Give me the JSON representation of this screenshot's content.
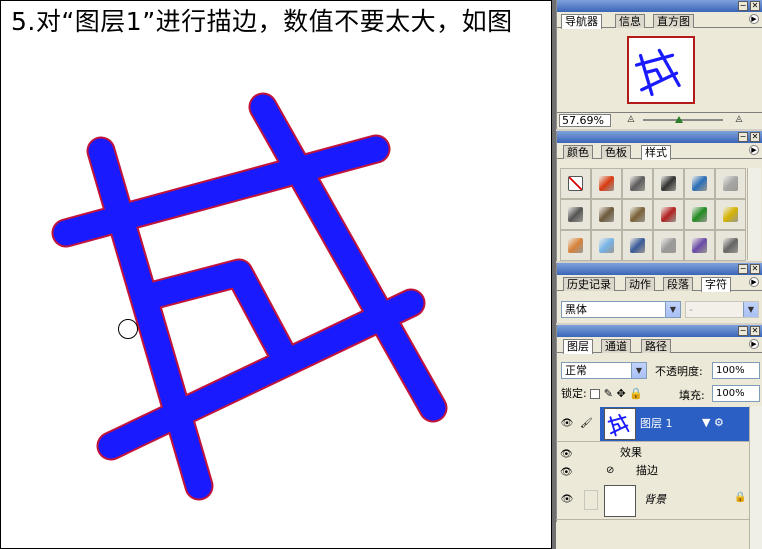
{
  "caption": "5.对“图层1”进行描边，数值不要太大，如图",
  "colors": {
    "stroke_fill": "#1a1aff",
    "stroke_outline": "#c0143c",
    "titlebar": "#3a66b8",
    "selected_layer": "#2b5fc3"
  },
  "navigator": {
    "tabs": [
      "导航器",
      "信息",
      "直方图"
    ],
    "zoom": "57.69%",
    "zoom_fraction": 0.45
  },
  "swatches_panel": {
    "tabs": [
      "颜色",
      "色板",
      "样式"
    ],
    "style_swatches": [
      {
        "icon": "none-style-icon",
        "color": "#ffffff"
      },
      {
        "icon": "glow-style-icon",
        "color": "#d83a10"
      },
      {
        "icon": "gray-style-icon",
        "color": "#5c5c5c"
      },
      {
        "icon": "chrome-style-icon",
        "color": "#333333"
      },
      {
        "icon": "blue-bevel-style-icon",
        "color": "#2a6eb8"
      },
      {
        "icon": "flat-gray-style-icon",
        "color": "#a6a6a6"
      },
      {
        "icon": "dark-bevel-style-icon",
        "color": "#555555"
      },
      {
        "icon": "wood-style-icon",
        "color": "#6d5a3a"
      },
      {
        "icon": "bronze-style-icon",
        "color": "#7a6138"
      },
      {
        "icon": "brick-style-icon",
        "color": "#b22222"
      },
      {
        "icon": "multicolor-style-icon",
        "color": "#228b22"
      },
      {
        "icon": "gold-style-icon",
        "color": "#d4b200"
      },
      {
        "icon": "orange-gradient-style-icon",
        "color": "#d8823a"
      },
      {
        "icon": "sky-style-icon",
        "color": "#76b3e8"
      },
      {
        "icon": "sunset-style-icon",
        "color": "#3a5a9a"
      },
      {
        "icon": "sparkle-style-icon",
        "color": "#9a9a9a"
      },
      {
        "icon": "purple-style-icon",
        "color": "#6a4aa8"
      },
      {
        "icon": "charcoal-style-icon",
        "color": "#666666"
      }
    ]
  },
  "character_panel": {
    "tabs": [
      "历史记录",
      "动作",
      "段落",
      "字符"
    ],
    "font_family": "黑体",
    "font_style": "-"
  },
  "layers_panel": {
    "tabs": [
      "图层",
      "通道",
      "路径"
    ],
    "blend_mode": "正常",
    "opacity_label": "不透明度:",
    "opacity_value": "100%",
    "lock_label": "锁定:",
    "fill_label": "填充:",
    "fill_value": "100%",
    "layers": [
      {
        "name": "图层 1",
        "selected": true,
        "effects_label": "效果",
        "effects": [
          "描边"
        ]
      },
      {
        "name": "背景",
        "selected": false,
        "locked": true
      }
    ]
  }
}
